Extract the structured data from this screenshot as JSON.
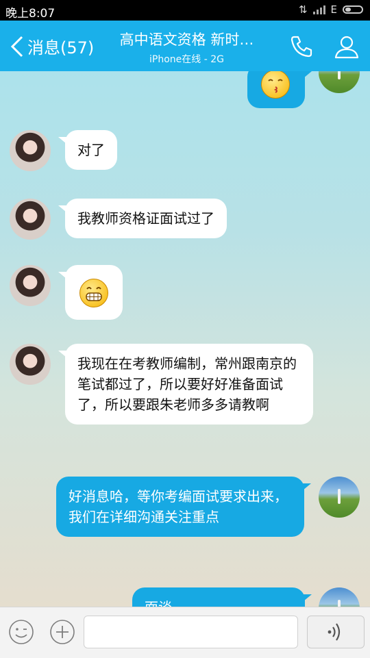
{
  "status_bar": {
    "time": "晚上8:07",
    "network": "E"
  },
  "header": {
    "back_label": "消息(57)",
    "title": "高中语文资格 新时…",
    "subtitle": "iPhone在线 - 2G"
  },
  "messages": [
    {
      "from": "other",
      "text": "对了"
    },
    {
      "from": "other",
      "text": "我教师资格证面试过了"
    },
    {
      "from": "other",
      "text": "",
      "emoji": "grin-emoji"
    },
    {
      "from": "other",
      "text": "我现在在考教师编制，常州跟南京的笔试都过了，所以要好好准备面试了，所以要跟朱老师多多请教啊"
    },
    {
      "from": "self",
      "text": "好消息哈，等你考编面试要求出来，我们在详细沟通关注重点"
    },
    {
      "from": "self",
      "text": "面谈..."
    }
  ],
  "top_partial_emoji": "kiss-emoji",
  "input": {
    "placeholder": ""
  },
  "colors": {
    "header": "#1ab0ea",
    "out_bubble": "#17a9e3",
    "in_bubble": "#ffffff"
  }
}
